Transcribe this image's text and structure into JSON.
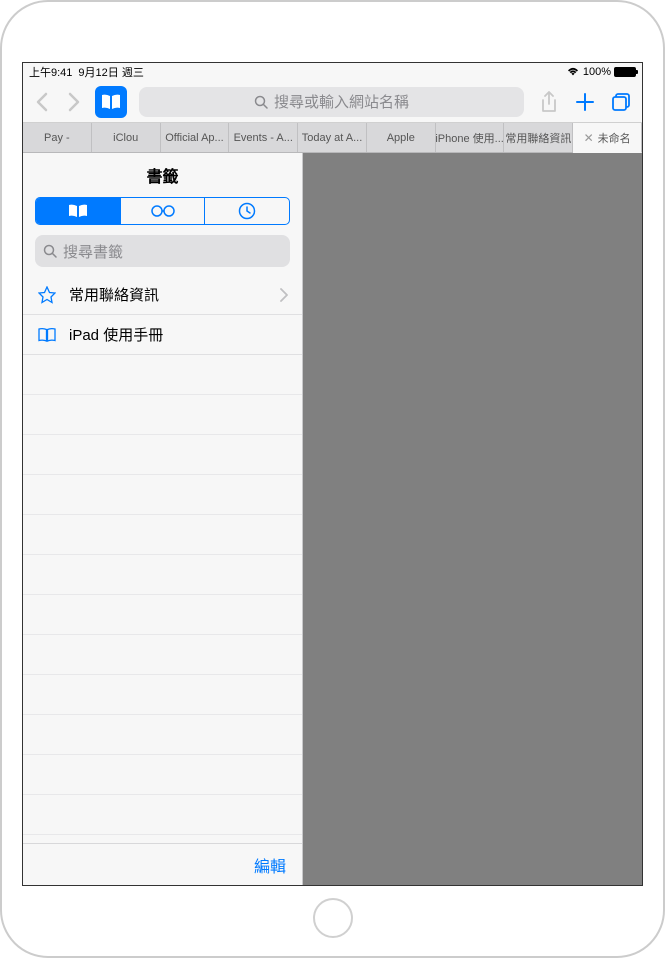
{
  "status": {
    "time": "上午9:41",
    "date": "9月12日 週三",
    "battery": "100%"
  },
  "toolbar": {
    "address_placeholder": "搜尋或輸入網站名稱"
  },
  "tabs": [
    {
      "label": "Pay -"
    },
    {
      "label": "iClou"
    },
    {
      "label": "Official Ap..."
    },
    {
      "label": "Events - A..."
    },
    {
      "label": "Today at A..."
    },
    {
      "label": "Apple"
    },
    {
      "label": "iPhone 使用..."
    },
    {
      "label": "常用聯絡資訊"
    },
    {
      "label": "未命名"
    }
  ],
  "sidebar": {
    "title": "書籤",
    "search_placeholder": "搜尋書籤",
    "items": [
      {
        "label": "常用聯絡資訊",
        "icon": "star",
        "has_chevron": true
      },
      {
        "label": "iPad 使用手冊",
        "icon": "book",
        "has_chevron": false
      }
    ],
    "edit_label": "編輯"
  }
}
